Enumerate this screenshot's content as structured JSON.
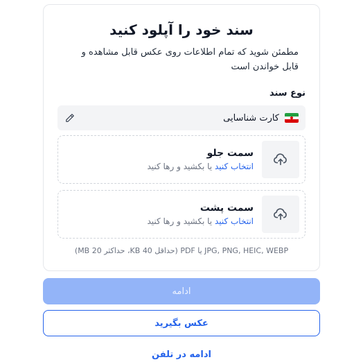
{
  "header": {
    "title": "سند خود را آپلود کنید",
    "subtitle": "مطمئن شوید که تمام اطلاعات روی عکس قابل مشاهده و قابل خواندن است"
  },
  "document_type": {
    "label": "نوع سند",
    "selected": "کارت شناسایی",
    "flag_icon": "iran-flag-icon",
    "edit_icon": "pencil-icon"
  },
  "uploads": {
    "front": {
      "title": "سمت جلو",
      "choose_link": "انتخاب کنید",
      "hint_rest": " یا بکشید و رها کنید",
      "icon": "cloud-upload-icon"
    },
    "back": {
      "title": "سمت پشت",
      "choose_link": "انتخاب کنید",
      "hint_rest": " یا بکشید و رها کنید",
      "icon": "cloud-upload-icon"
    }
  },
  "formats_note": "JPG, PNG, HEIC, WEBP یا PDF (حداقل 40 KB، حداکثر 20 MB)",
  "actions": {
    "continue_label": "ادامه",
    "take_photo_label": "عکس بگیرید",
    "continue_on_phone_label": "ادامه در تلفن"
  },
  "colors": {
    "accent": "#2563eb",
    "continue_disabled": "#93b4f8",
    "border": "#e5e7eb"
  }
}
